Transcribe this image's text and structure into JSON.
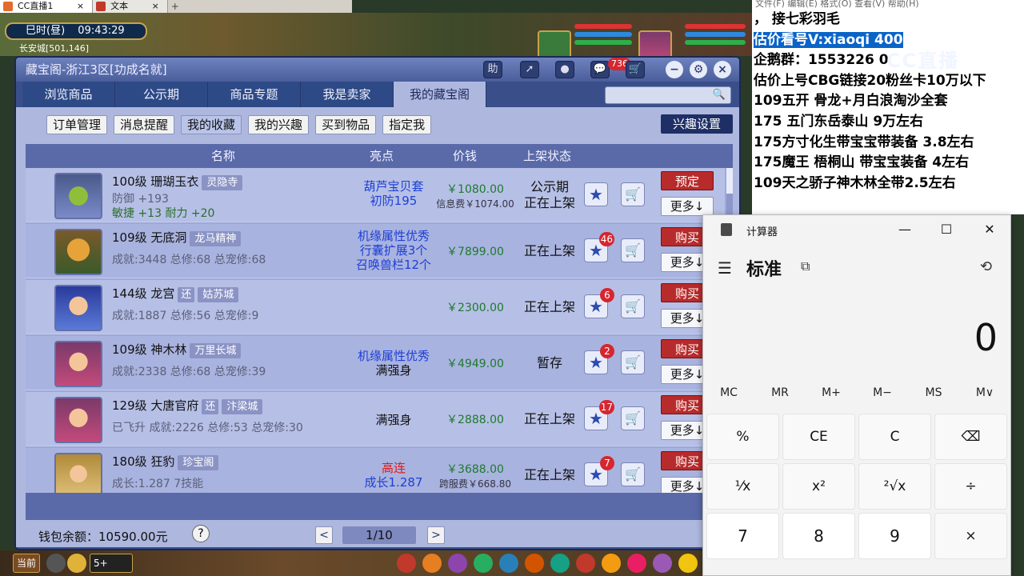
{
  "browser": {
    "tabs": [
      {
        "label": "CC直播1",
        "close": "×"
      },
      {
        "label": "文本",
        "close": "×"
      }
    ],
    "new_tab": "+"
  },
  "game": {
    "clock_label": "巳时(昼)",
    "clock_time": "09:43:29",
    "location": "长安城[501,146]",
    "bottom_left_label": "当前",
    "bottom_chat": "5+"
  },
  "window": {
    "title": "藏宝阁-浙江3区[功成名就]",
    "help_btn": "助",
    "mail_badge": "736",
    "main_tabs": [
      "浏览商品",
      "公示期",
      "商品专题",
      "我是卖家",
      "我的藏宝阁"
    ],
    "active_main_tab": 4,
    "sub_tabs": [
      "订单管理",
      "消息提醒",
      "我的收藏",
      "我的兴趣",
      "买到物品",
      "指定我"
    ],
    "active_sub_tab": 2,
    "interest_button": "兴趣设置",
    "columns": [
      "名称",
      "亮点",
      "价钱",
      "上架状态"
    ],
    "rows": [
      {
        "name": "100级 珊瑚玉衣",
        "tag": "灵隐寺",
        "stats": [
          "防御 +193",
          "敏捷 +13 耐力 +20"
        ],
        "highlight": [
          "葫芦宝贝套",
          "初防195"
        ],
        "highlight_color": "blue",
        "price": "￥1080.00",
        "price_sub": "信息费￥1074.00",
        "status": [
          "公示期",
          "正在上架"
        ],
        "favorites": "",
        "action": "预定",
        "more": "更多↓"
      },
      {
        "name": "109级 无底洞",
        "tag": "龙马精神",
        "stats": [
          "成就:3448 总修:68 总宠修:68"
        ],
        "highlight": [
          "机缘属性优秀",
          "行囊扩展3个",
          "召唤兽栏12个"
        ],
        "highlight_color": "blue",
        "price": "￥7899.00",
        "price_sub": "",
        "status": [
          "正在上架"
        ],
        "favorites": "46",
        "action": "购买",
        "more": "更多↓"
      },
      {
        "name": "144级 龙宫",
        "tag_small": "还",
        "tag": "姑苏城",
        "stats": [
          "成就:1887 总修:56 总宠修:9"
        ],
        "highlight": [],
        "highlight_color": "blue",
        "price": "￥2300.00",
        "price_sub": "",
        "status": [
          "正在上架"
        ],
        "favorites": "6",
        "action": "购买",
        "more": "更多↓"
      },
      {
        "name": "109级 神木林",
        "tag": "万里长城",
        "stats": [
          "成就:2338 总修:68 总宠修:39"
        ],
        "highlight": [
          "机缘属性优秀"
        ],
        "highlight2": "满强身",
        "highlight_color": "blue",
        "price": "￥4949.00",
        "price_sub": "",
        "status": [
          "暂存"
        ],
        "favorites": "2",
        "action": "购买",
        "more": "更多↓"
      },
      {
        "name": "129级 大唐官府",
        "tag_small": "还",
        "tag": "汴梁城",
        "stats": [
          "已飞升 成就:2226 总修:53 总宠修:30"
        ],
        "highlight": [],
        "highlight2": "满强身",
        "highlight_color": "dark",
        "price": "￥2888.00",
        "price_sub": "",
        "status": [
          "正在上架"
        ],
        "favorites": "17",
        "action": "购买",
        "more": "更多↓"
      },
      {
        "name": "180级 狂豹",
        "tag": "珍宝阁",
        "stats": [
          "成长:1.287 7技能"
        ],
        "highlight": [
          "高连"
        ],
        "highlight2": "成长1.287",
        "highlight_color": "red",
        "price": "￥3688.00",
        "price_sub": "跨服费￥668.80",
        "status": [
          "正在上架"
        ],
        "favorites": "7",
        "action": "购买",
        "more": "更多↓"
      }
    ],
    "wallet": "钱包余额：10590.00元",
    "help": "?",
    "page": "1/10",
    "prev": "<",
    "next": ">"
  },
  "notepad": {
    "menu": "文件(F)   编辑(E)   格式(O)   查看(V)   帮助(H)",
    "lines": [
      "，   接七彩羽毛",
      "估价看号V:xiaoqi  400",
      "企鹅群：1553226  0",
      "估价上号CBG链接20粉丝卡10万以下",
      "109五开 骨龙+月白浪淘沙全套",
      "175 五门东岳泰山  9万左右",
      "175方寸化生带宝宝带装备  3.8左右",
      "175魔王 梧桐山  带宝宝装备 4左右",
      "109天之骄子神木林全带2.5左右"
    ],
    "watermark": "CC直播"
  },
  "calculator": {
    "title": "计算器",
    "mode": "标准",
    "display": "0",
    "memory": [
      "MC",
      "MR",
      "M+",
      "M−",
      "MS",
      "M∨"
    ],
    "keys": [
      "%",
      "CE",
      "C",
      "⌫",
      "¹⁄x",
      "x²",
      "²√x",
      "÷",
      "7",
      "8",
      "9",
      "×"
    ]
  }
}
